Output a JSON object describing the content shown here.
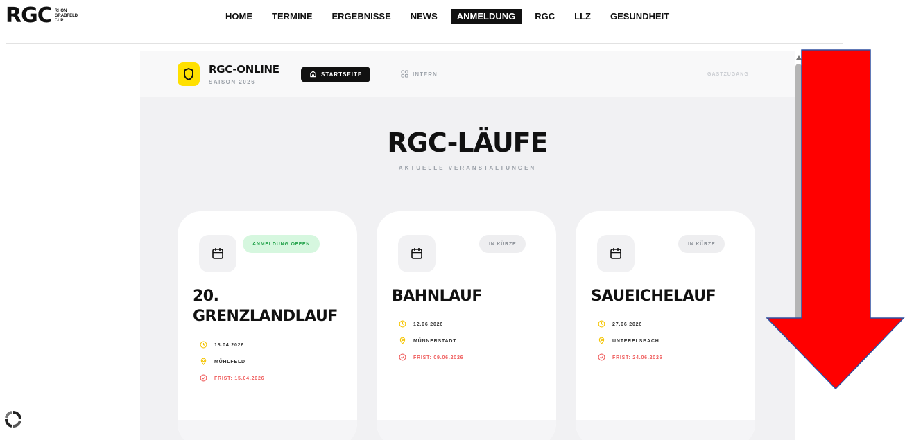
{
  "site": {
    "logo": {
      "big": "RGC",
      "line1": "RHÖN",
      "line2": "GRABFELD",
      "line3": "CUP"
    },
    "nav": [
      "HOME",
      "TERMINE",
      "ERGEBNISSE",
      "NEWS",
      "ANMELDUNG",
      "RGC",
      "LLZ",
      "GESUNDHEIT"
    ],
    "active_nav": "ANMELDUNG"
  },
  "app": {
    "brand_title": "RGC-ONLINE",
    "brand_sub": "SAISON 2026",
    "start_button": "STARTSEITE",
    "intern_button": "INTERN",
    "guest_label": "GASTZUGANG",
    "page_title": "RGC-LÄUFE",
    "page_subtitle": "AKTUELLE VERANSTALTUNGEN"
  },
  "cards": [
    {
      "badge": "ANMELDUNG OFFEN",
      "badge_state": "open",
      "title_line1": "20.",
      "title_line2": "GRENZLANDLAUF",
      "date": "18.04.2026",
      "location": "MÜHLFELD",
      "deadline": "FRIST: 15.04.2026"
    },
    {
      "badge": "IN KÜRZE",
      "badge_state": "soon",
      "title_line1": "BAHNLAUF",
      "title_line2": "",
      "date": "12.06.2026",
      "location": "MÜNNERSTADT",
      "deadline": "FRIST: 09.06.2026"
    },
    {
      "badge": "IN KÜRZE",
      "badge_state": "soon",
      "title_line1": "SAUEICHELAUF",
      "title_line2": "",
      "date": "27.06.2026",
      "location": "UNTERELSBACH",
      "deadline": "FRIST: 24.06.2026"
    }
  ],
  "colors": {
    "accent_yellow": "#ffe000",
    "open_green": "#22a24a",
    "deadline_red": "#ef5d5d",
    "arrow_red": "#ff0000"
  },
  "icons": [
    "shield-icon",
    "home-icon",
    "grid-icon",
    "calendar-icon",
    "clock-icon",
    "pin-icon",
    "check-circle-icon",
    "loader-icon",
    "arrow-down-icon"
  ]
}
